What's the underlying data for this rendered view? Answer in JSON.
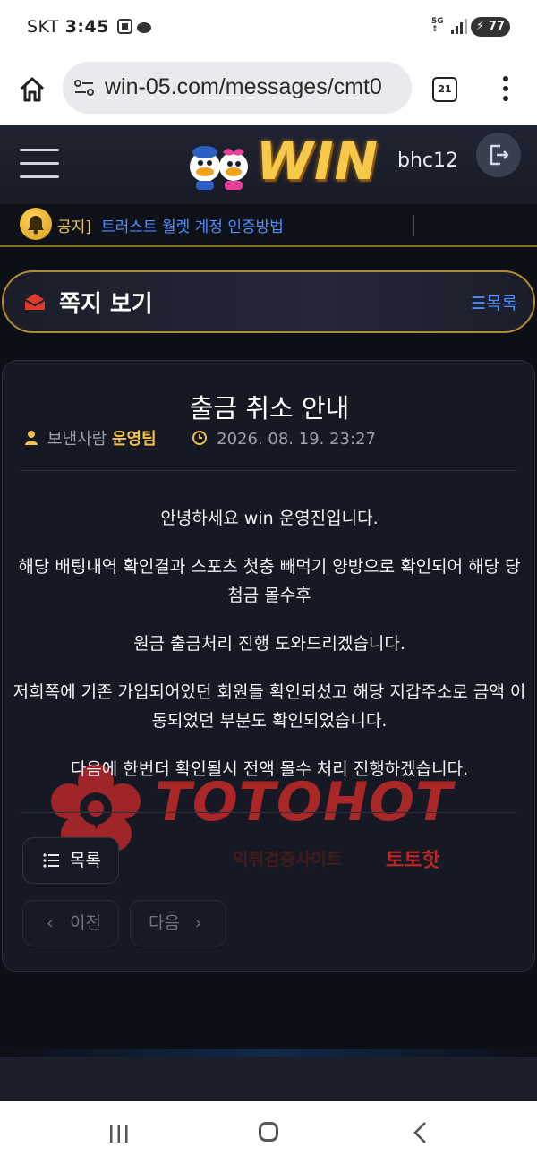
{
  "status_bar": {
    "carrier": "SKT",
    "time": "3:45",
    "network": "5G",
    "battery": "77"
  },
  "browser": {
    "url": "win-05.com/messages/cmt0",
    "tab_count": "21"
  },
  "site": {
    "logo_text": "WIN",
    "username": "bhc12",
    "notice": {
      "tag": "공지]",
      "text": "트러스트 월렛 계정 인증방법"
    },
    "section": {
      "title": "쪽지 보기",
      "list_link": "☰목록"
    }
  },
  "message": {
    "title": "출금 취소 안내",
    "sender_label": "보낸사람",
    "sender": "운영팀",
    "datetime": "2026. 08. 19. 23:27",
    "paragraphs": [
      "안녕하세요 win 운영진입니다.",
      "해당 배팅내역 확인결과 스포츠 첫충 빼먹기 양방으로 확인되어 해당 당첨금 몰수후",
      "원금 출금처리 진행 도와드리겠습니다.",
      "저희쪽에 기존 가입되어있던 회원들 확인되셨고 해당 지갑주소로 금액 이동되었던 부분도 확인되었습니다.",
      "다음에 한번더 확인될시 전액 몰수 처리 진행하겠습니다."
    ]
  },
  "buttons": {
    "list": "목록",
    "prev": "이전",
    "next": "다음"
  },
  "watermark": {
    "brand": "TOTOHOT",
    "sub": "먹튀검증사이트",
    "sub2": "토토핫"
  },
  "colors": {
    "accent_gold": "#f1c14d",
    "link_blue": "#4d8dff",
    "background": "#0d0f16"
  }
}
